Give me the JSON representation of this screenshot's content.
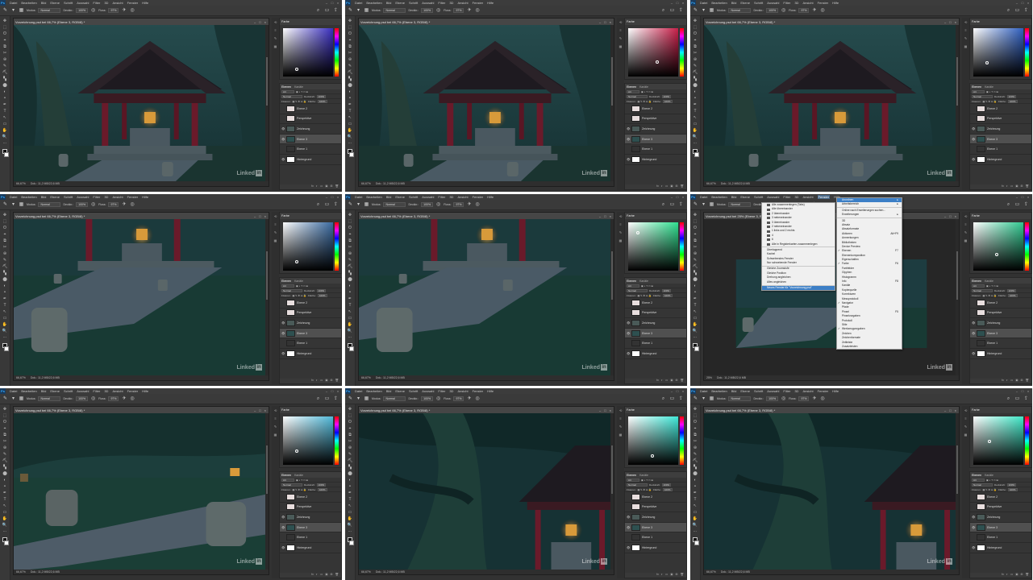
{
  "app": {
    "logo": "Ps",
    "menu": [
      "Datei",
      "Bearbeiten",
      "Bild",
      "Ebene",
      "Schrift",
      "Auswahl",
      "Filter",
      "3D",
      "Ansicht",
      "Fenster",
      "Hilfe"
    ],
    "window_controls": [
      "–",
      "□",
      "×"
    ]
  },
  "options_bar": {
    "modus_label": "Modus:",
    "modus_value": "Normal",
    "deckkraft_label": "Deckkr.:",
    "deckkraft_value": "100%",
    "fluss_label": "Fluss:",
    "fluss_value": "97%"
  },
  "tools": [
    "✥",
    "⬚",
    "ʘ",
    "⌖",
    "⧉",
    "✂",
    "⊕",
    "✎",
    "⛏",
    "▚",
    "⬤",
    "◐",
    "◓",
    "✒",
    "T",
    "↖",
    "▭",
    "✋",
    "🔍",
    "⋯"
  ],
  "document": {
    "title_a": "Vorzeichnung.psd bei 66,7% (Ebene 3, RGB/8) *",
    "title_b": "Vorzeichnung.psd bei 25% (Ebene 3, RGB/8) *",
    "zoom_a": "66,67%",
    "zoom_b": "25%",
    "doc_info": "Dok.: 11,2 MB/22,6 MB",
    "ctrls": [
      "–",
      "□",
      "×"
    ],
    "watermark": "Linked",
    "watermark_in": "in"
  },
  "color_panel": {
    "tab": "Farbe"
  },
  "layers_panel": {
    "tabs": [
      "Ebenen",
      "Kanäle"
    ],
    "filter_label": "Art",
    "blend_mode": "Normal",
    "opacity_label": "Deckkraft:",
    "opacity_value": "100%",
    "lock_label": "Fixieren:",
    "fill_label": "Fläche:",
    "fill_value": "100%",
    "layers": [
      {
        "name": "Ebene 2",
        "visible": false,
        "selected": false,
        "thumb": "#e8dede"
      },
      {
        "name": "Perspektive",
        "visible": false,
        "selected": false,
        "thumb": "#e8dede"
      },
      {
        "name": "Zeichnung",
        "visible": true,
        "selected": false,
        "thumb": "#4a5a58"
      },
      {
        "name": "Ebene 3",
        "visible": true,
        "selected": true,
        "thumb": "#2e5050"
      },
      {
        "name": "Ebene 1",
        "visible": false,
        "selected": false,
        "thumb": "#333333"
      },
      {
        "name": "Hintergrund",
        "visible": true,
        "selected": false,
        "thumb": "#ffffff"
      }
    ],
    "footer_icons": [
      "fx",
      "◐",
      "▭",
      "▣",
      "⊞",
      "🗑"
    ]
  },
  "panes": [
    {
      "row": 0,
      "col": 0,
      "scene": "gazebo",
      "picker": [
        "#3a2fbf",
        "#2a2aa8"
      ],
      "pt": [
        0.28,
        0.85
      ]
    },
    {
      "row": 0,
      "col": 1,
      "scene": "gazebo",
      "picker": [
        "#c8204a",
        "#a01838"
      ],
      "pt": [
        0.58,
        0.7
      ]
    },
    {
      "row": 0,
      "col": 2,
      "scene": "gazebo",
      "picker": [
        "#3060c0",
        "#2048a0"
      ],
      "pt": [
        0.28,
        0.72
      ]
    },
    {
      "row": 1,
      "col": 0,
      "scene": "path",
      "picker": [
        "#3a6aa0",
        "#2a5488"
      ],
      "pt": [
        0.28,
        0.82
      ]
    },
    {
      "row": 1,
      "col": 1,
      "scene": "path2",
      "picker": [
        "#30e090",
        "#20c078"
      ],
      "pt": [
        0.2,
        0.22
      ]
    },
    {
      "row": 1,
      "col": 2,
      "scene": "zoomed",
      "picker": [
        "#30c890",
        "#20a878"
      ],
      "pt": [
        0.47,
        0.67
      ]
    },
    {
      "row": 2,
      "col": 0,
      "scene": "stones",
      "picker": [
        "#50b8d8",
        "#3a98b8"
      ],
      "pt": [
        0.28,
        0.72
      ]
    },
    {
      "row": 2,
      "col": 1,
      "scene": "tree",
      "picker": [
        "#40e8d8",
        "#30c8c0"
      ],
      "pt": [
        0.48,
        0.82
      ]
    },
    {
      "row": 2,
      "col": 2,
      "scene": "tree",
      "picker": [
        "#40e8c8",
        "#30c8b0"
      ],
      "pt": [
        0.33,
        0.52
      ]
    }
  ],
  "window_menu": {
    "submenu_items": [
      {
        "label": "Alle zusammenlegen (Tabs)",
        "icon": true
      },
      {
        "label": "Alle übereinander",
        "icon": true
      },
      {
        "label": "2 übereinander",
        "icon": true
      },
      {
        "label": "3 nebeneinander",
        "icon": true
      },
      {
        "label": "3 übereinander",
        "icon": true
      },
      {
        "label": "2 nebeneinander",
        "icon": true
      },
      {
        "label": "1 links und 2 rechts",
        "icon": true
      },
      {
        "label": "4",
        "icon": true
      },
      {
        "label": "6",
        "icon": true
      },
      {
        "label": "Alle in Registerkarten zusammenlegen",
        "icon": true
      },
      {
        "sep": true
      },
      {
        "label": "Überlappend"
      },
      {
        "label": "Kachel"
      },
      {
        "label": "Schwebendes Fenster"
      },
      {
        "label": "Nur schwebende Fenster"
      },
      {
        "sep": true
      },
      {
        "label": "Gleiche Zoomstufe"
      },
      {
        "label": "Gleiche Position"
      },
      {
        "label": "Drehung angleichen"
      },
      {
        "label": "Alles angleichen"
      },
      {
        "sep": true
      },
      {
        "label": "Neues Fenster für \"Vorzeichnung.psd\"",
        "hl": true
      }
    ],
    "main_items": [
      {
        "label": "Anordnen",
        "hl": true,
        "arrow": "▸"
      },
      {
        "label": "Arbeitsbereich",
        "arrow": "▸"
      },
      {
        "sep": true
      },
      {
        "label": "Online nach Erweiterungen suchen..."
      },
      {
        "label": "Erweiterungen",
        "arrow": "▸"
      },
      {
        "sep": true
      },
      {
        "label": "3D"
      },
      {
        "label": "Absatz"
      },
      {
        "label": "Absatzformate"
      },
      {
        "label": "Aktionen",
        "sc": "Alt+F9"
      },
      {
        "label": "Anmerkungen"
      },
      {
        "label": "Bibliotheken"
      },
      {
        "label": "Device Preview"
      },
      {
        "label": "Ebenen",
        "sc": "F7",
        "checked": true
      },
      {
        "label": "Ebenenkomposition"
      },
      {
        "label": "Eigenschaften"
      },
      {
        "label": "Farbe",
        "sc": "F6",
        "checked": true
      },
      {
        "label": "Farbfelder"
      },
      {
        "label": "Glyphen"
      },
      {
        "label": "Histogramm"
      },
      {
        "label": "Info",
        "sc": "F8"
      },
      {
        "label": "Kanäle"
      },
      {
        "label": "Kopierquelle"
      },
      {
        "label": "Korrekturen"
      },
      {
        "label": "Messprotokoll"
      },
      {
        "label": "Navigator",
        "checked": true
      },
      {
        "label": "Pfade"
      },
      {
        "label": "Pinsel",
        "sc": "F5"
      },
      {
        "label": "Pinselvorgaben"
      },
      {
        "label": "Protokoll"
      },
      {
        "label": "Stile"
      },
      {
        "label": "Werkzeugvorgaben",
        "checked": true
      },
      {
        "label": "Zeichen"
      },
      {
        "label": "Zeichenformate"
      },
      {
        "label": "Zeitleiste"
      },
      {
        "label": "Zusatzleisten"
      }
    ]
  }
}
